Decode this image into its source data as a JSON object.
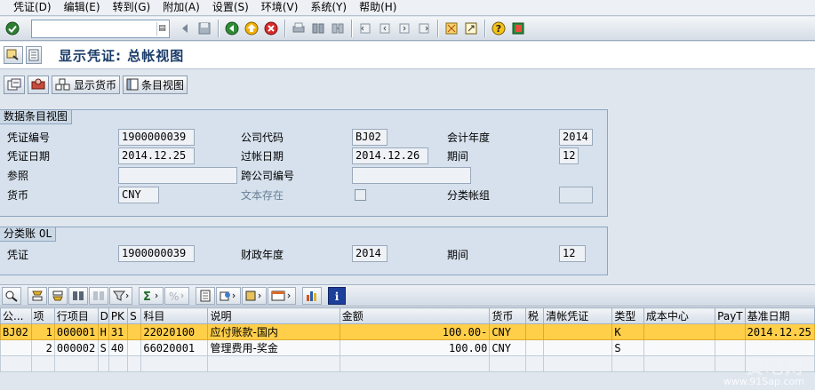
{
  "menu": [
    "凭证(D)",
    "编辑(E)",
    "转到(G)",
    "附加(A)",
    "设置(S)",
    "环境(V)",
    "系统(Y)",
    "帮助(H)"
  ],
  "command_field": {
    "value": ""
  },
  "title": "显示凭证: 总帐视图",
  "app_toolbar": {
    "display_currency": "显示货币",
    "entry_view": "条目视图"
  },
  "data_entry_view": {
    "header": "数据条目视图",
    "doc_number_label": "凭证编号",
    "doc_number": "1900000039",
    "company_code_label": "公司代码",
    "company_code": "BJ02",
    "fiscal_year_label": "会计年度",
    "fiscal_year": "2014",
    "doc_date_label": "凭证日期",
    "doc_date": "2014.12.25",
    "posting_date_label": "过帐日期",
    "posting_date": "2014.12.26",
    "period_label": "期间",
    "period": "12",
    "reference_label": "参照",
    "reference": "",
    "cross_cc_label": "跨公司编号",
    "cross_cc": "",
    "currency_label": "货币",
    "currency": "CNY",
    "text_exists_label": "文本存在",
    "ledger_group_label": "分类帐组",
    "ledger_group": ""
  },
  "ledger": {
    "header": "分类账 0L",
    "doc_label": "凭证",
    "doc": "1900000039",
    "fiscal_year_label": "财政年度",
    "fiscal_year": "2014",
    "period_label": "期间",
    "period": "12"
  },
  "grid": {
    "columns": [
      "公...",
      "项",
      "行项目",
      "D",
      "PK",
      "S",
      "科目",
      "说明",
      "金额",
      "货币",
      "税",
      "清帐凭证",
      "类型",
      "成本中心",
      "PayT",
      "基准日期"
    ],
    "rows": [
      {
        "co": "BJ02",
        "item": "1",
        "line": "000001",
        "dc": "H",
        "pk": "31",
        "s": "",
        "account": "22020100",
        "desc": "应付账款-国内",
        "amount": "100.00-",
        "curr": "CNY",
        "tax": "",
        "clearing": "",
        "type": "K",
        "cost_center": "",
        "payt": "",
        "base_date": "2014.12.25"
      },
      {
        "co": "",
        "item": "2",
        "line": "000002",
        "dc": "S",
        "pk": "40",
        "s": "",
        "account": "66020001",
        "desc": "管理费用-奖金",
        "amount": "100.00",
        "curr": "CNY",
        "tax": "",
        "clearing": "",
        "type": "S",
        "cost_center": "",
        "payt": "",
        "base_date": ""
      }
    ]
  },
  "watermark": {
    "brand": "赞吧网",
    "url": "www.91Sap.com"
  },
  "colors": {
    "selected_row": "#ffcf4a",
    "title": "#1b3d6a",
    "group_bg": "#d6e1ed"
  }
}
